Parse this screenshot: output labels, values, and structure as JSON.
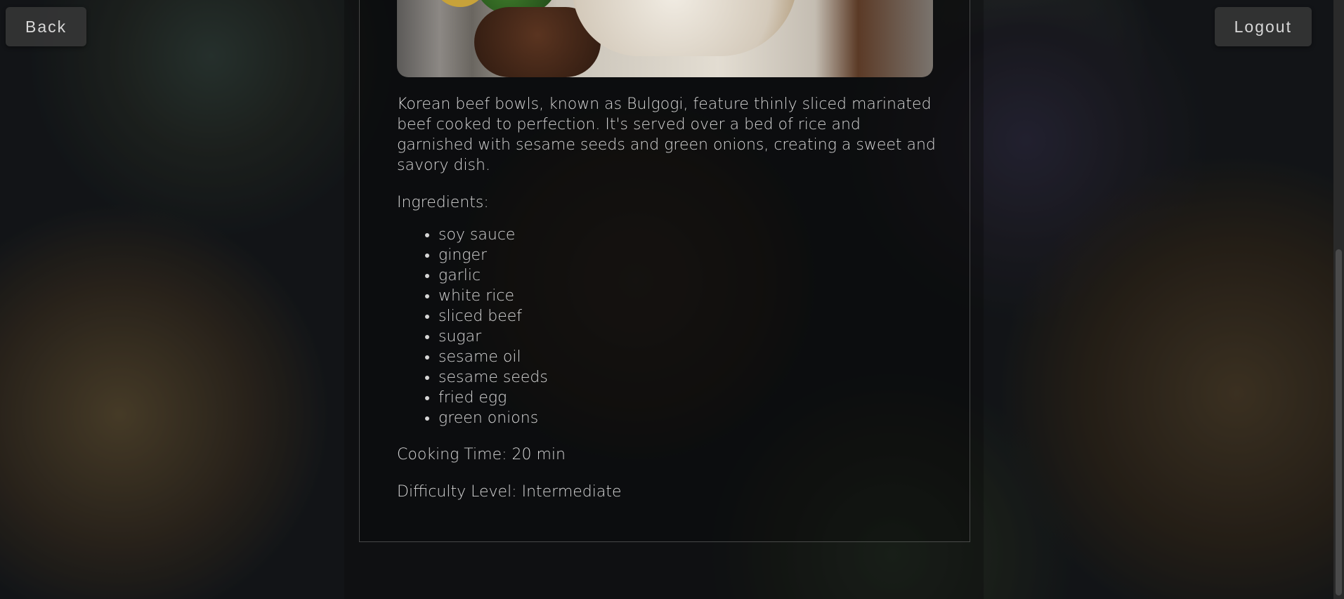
{
  "nav": {
    "back_label": "Back",
    "logout_label": "Logout"
  },
  "recipe": {
    "description": "Korean beef bowls, known as Bulgogi, feature thinly sliced marinated beef cooked to perfection. It's served over a bed of rice and garnished with sesame seeds and green onions, creating a sweet and savory dish.",
    "ingredients_heading": "Ingredients:",
    "ingredients": [
      "soy sauce",
      "ginger",
      "garlic",
      "white rice",
      "sliced beef",
      "sugar",
      "sesame oil",
      "sesame seeds",
      "fried egg",
      "green onions"
    ],
    "cooking_time": "Cooking Time: 20 min",
    "difficulty": "Difficulty Level: Intermediate"
  }
}
